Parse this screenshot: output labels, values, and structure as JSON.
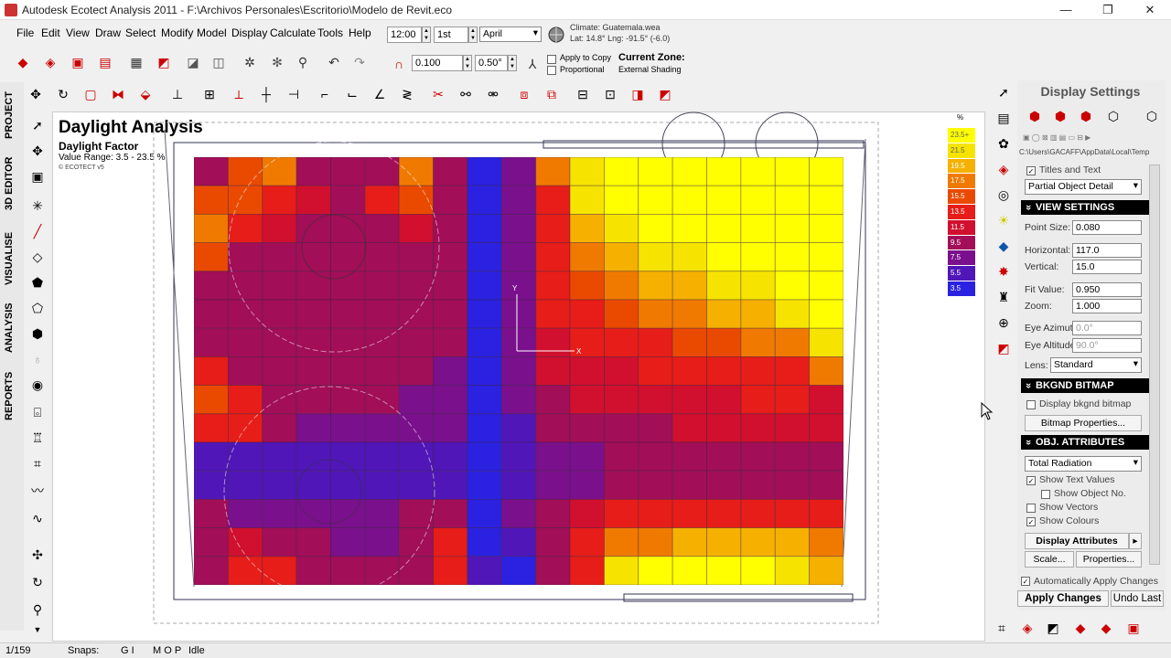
{
  "window": {
    "title": "Autodesk Ecotect Analysis 2011 - F:\\Archivos Personales\\Escritorio\\Modelo de Revit.eco",
    "min": "—",
    "restore": "❐",
    "close": "✕"
  },
  "menu": [
    "File",
    "Edit",
    "View",
    "Draw",
    "Select",
    "Modify",
    "Model",
    "Display",
    "Calculate",
    "Tools",
    "Help"
  ],
  "toolbar": {
    "time": "12:00",
    "day": "1st",
    "month": "April",
    "climate_file": "Climate: Guatemala.wea",
    "climate_coords": "Lat: 14.8°   Lng: -91.5° (-6.0)",
    "offset": "0.100",
    "snap": "0.50°",
    "apply_to_copy": "Apply to Copy",
    "proportional": "Proportional",
    "current_zone_label": "Current Zone:",
    "current_zone_value": "External Shading"
  },
  "left_tabs": [
    "PROJECT",
    "3D EDITOR",
    "VISUALISE",
    "ANALYSIS",
    "REPORTS"
  ],
  "viewport": {
    "title": "Daylight Analysis",
    "subtitle": "Daylight Factor",
    "range": "Value Range: 3.5 - 23.5 %",
    "brand": "© ECOTECT v5"
  },
  "scale": {
    "unit": "%",
    "steps": [
      {
        "label": "23.5+",
        "color": "#ffff00"
      },
      {
        "label": "21.5",
        "color": "#f6e400"
      },
      {
        "label": "19.5",
        "color": "#f5b000"
      },
      {
        "label": "17.5",
        "color": "#f07a00"
      },
      {
        "label": "15.5",
        "color": "#ea4a00"
      },
      {
        "label": "13.5",
        "color": "#e61d18"
      },
      {
        "label": "11.5",
        "color": "#d0102e"
      },
      {
        "label": "9.5",
        "color": "#a20e58"
      },
      {
        "label": "7.5",
        "color": "#7a108c"
      },
      {
        "label": "5.5",
        "color": "#5016b8"
      },
      {
        "label": "3.5",
        "color": "#2a22e0"
      }
    ]
  },
  "panel": {
    "title": "Display Settings",
    "path": "C:\\Users\\GACAFF\\AppData\\Local\\Temp",
    "titles_and_text": "Titles and Text",
    "detail": "Partial Object Detail",
    "view_settings": "VIEW SETTINGS",
    "point_size_label": "Point Size:",
    "point_size": "0.080",
    "horizontal_label": "Horizontal:",
    "horizontal": "117.0",
    "vertical_label": "Vertical:",
    "vertical": "15.0",
    "fit_label": "Fit Value:",
    "fit": "0.950",
    "zoom_label": "Zoom:",
    "zoom": "1.000",
    "eye_az_label": "Eye Azimuth:",
    "eye_az": "0.0°",
    "eye_alt_label": "Eye Altitude:",
    "eye_alt": "90.0°",
    "lens_label": "Lens:",
    "lens": "Standard",
    "bkgnd": "BKGND BITMAP",
    "display_bkgnd": "Display bkgnd bitmap",
    "bitmap_props": "Bitmap Properties...",
    "obj_attr": "OBJ. ATTRIBUTES",
    "attribute": "Total Radiation",
    "show_text": "Show Text Values",
    "show_obj_no": "Show Object No.",
    "show_vectors": "Show Vectors",
    "show_colours": "Show Colours",
    "display_attributes": "Display Attributes",
    "scale_btn": "Scale...",
    "properties_btn": "Properties...",
    "auto_apply": "Automatically Apply Changes",
    "apply_changes": "Apply Changes",
    "undo_last": "Undo Last"
  },
  "status": {
    "page": "1/159",
    "snaps_label": "Snaps:",
    "snaps1": "G I",
    "snaps2": "M O P",
    "state": "Idle"
  },
  "grid": {
    "cols": 19,
    "rows": [
      [
        8,
        15,
        16,
        9,
        9,
        9,
        16,
        8,
        3,
        7,
        16,
        21,
        23,
        23,
        23,
        23,
        23,
        23,
        23
      ],
      [
        14,
        14,
        13,
        11,
        9,
        13,
        14,
        8,
        3,
        7,
        13,
        20,
        22,
        23,
        23,
        23,
        23,
        23,
        23
      ],
      [
        16,
        13,
        11,
        9,
        9,
        9,
        11,
        8,
        3,
        7,
        13,
        18,
        20,
        22,
        23,
        23,
        23,
        23,
        23
      ],
      [
        14,
        9,
        9,
        9,
        9,
        9,
        9,
        8,
        3,
        7,
        13,
        16,
        19,
        20,
        21,
        22,
        23,
        23,
        23
      ],
      [
        9,
        9,
        9,
        9,
        9,
        9,
        9,
        8,
        3,
        6,
        13,
        14,
        16,
        18,
        19,
        20,
        21,
        22,
        23
      ],
      [
        9,
        9,
        9,
        9,
        9,
        9,
        9,
        8,
        3,
        6,
        12,
        13,
        14,
        16,
        17,
        18,
        19,
        20,
        22
      ],
      [
        9,
        9,
        9,
        9,
        9,
        9,
        9,
        8,
        3,
        6,
        11,
        12,
        13,
        13,
        14,
        15,
        16,
        17,
        20
      ],
      [
        13,
        9,
        9,
        9,
        9,
        9,
        8,
        7,
        3,
        6,
        10,
        11,
        11,
        12,
        12,
        13,
        13,
        13,
        16
      ],
      [
        14,
        13,
        9,
        9,
        8,
        8,
        7,
        7,
        3,
        6,
        9,
        10,
        10,
        11,
        11,
        11,
        12,
        12,
        11
      ],
      [
        13,
        12,
        8,
        7,
        7,
        6,
        6,
        6,
        3,
        5,
        8,
        9,
        9,
        9,
        10,
        10,
        10,
        10,
        10
      ],
      [
        5,
        5,
        5,
        5,
        4,
        4,
        4,
        4,
        3,
        4,
        6,
        7,
        8,
        8,
        8,
        8,
        8,
        8,
        9
      ],
      [
        5,
        4,
        4,
        4,
        4,
        4,
        4,
        4,
        3,
        4,
        6,
        7,
        8,
        9,
        9,
        9,
        9,
        9,
        9
      ],
      [
        8,
        7,
        7,
        7,
        7,
        7,
        8,
        8,
        3,
        6,
        8,
        10,
        12,
        13,
        13,
        13,
        13,
        13,
        13
      ],
      [
        9,
        11,
        9,
        8,
        7,
        7,
        9,
        13,
        3,
        5,
        9,
        13,
        16,
        17,
        18,
        19,
        19,
        19,
        16
      ],
      [
        8,
        13,
        13,
        9,
        8,
        8,
        9,
        13,
        4,
        3,
        8,
        13,
        20,
        22,
        22,
        22,
        22,
        21,
        18
      ]
    ]
  }
}
